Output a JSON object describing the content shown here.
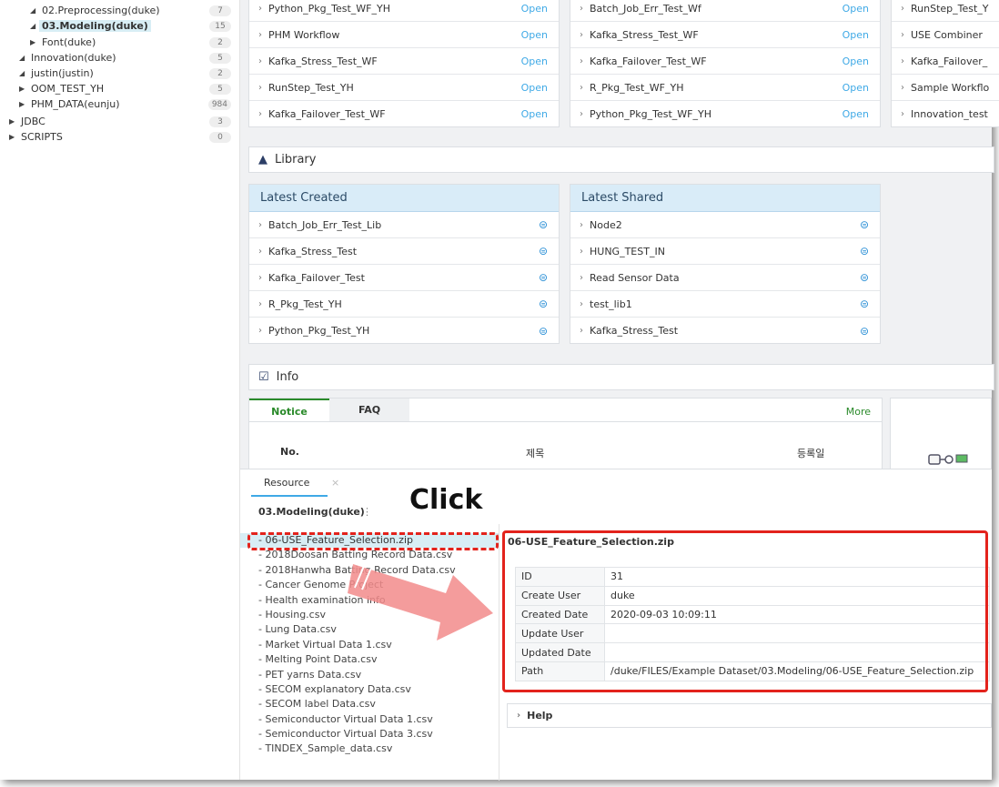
{
  "tree": {
    "items": [
      {
        "label": "02.Preprocessing(duke)",
        "count": "7",
        "arrow": "◢",
        "indent": 3
      },
      {
        "label": "03.Modeling(duke)",
        "count": "15",
        "arrow": "◢",
        "indent": 3,
        "selected": true
      },
      {
        "label": "Font(duke)",
        "count": "2",
        "arrow": "▶",
        "indent": 3
      },
      {
        "label": "Innovation(duke)",
        "count": "5",
        "arrow": "◢",
        "indent": 2
      },
      {
        "label": "justin(justin)",
        "count": "2",
        "arrow": "◢",
        "indent": 2
      },
      {
        "label": "OOM_TEST_YH",
        "count": "5",
        "arrow": "▶",
        "indent": 2
      },
      {
        "label": "PHM_DATA(eunju)",
        "count": "984",
        "arrow": "▶",
        "indent": 2
      },
      {
        "label": "JDBC",
        "count": "3",
        "arrow": "▶",
        "indent": 1
      },
      {
        "label": "SCRIPTS",
        "count": "0",
        "arrow": "▶",
        "indent": 1
      }
    ]
  },
  "workflows": {
    "col1": [
      "Python_Pkg_Test_WF_YH",
      "PHM Workflow",
      "Kafka_Stress_Test_WF",
      "RunStep_Test_YH",
      "Kafka_Failover_Test_WF"
    ],
    "col2": [
      "Batch_Job_Err_Test_Wf",
      "Kafka_Stress_Test_WF",
      "Kafka_Failover_Test_WF",
      "R_Pkg_Test_WF_YH",
      "Python_Pkg_Test_WF_YH"
    ],
    "col3": [
      "RunStep_Test_Y",
      "USE Combiner",
      "Kafka_Failover_",
      "Sample Workflo",
      "Innovation_test"
    ],
    "open_label": "Open"
  },
  "library": {
    "title": "Library",
    "latest_created": {
      "header": "Latest Created",
      "items": [
        "Batch_Job_Err_Test_Lib",
        "Kafka_Stress_Test",
        "Kafka_Failover_Test",
        "R_Pkg_Test_YH",
        "Python_Pkg_Test_YH"
      ]
    },
    "latest_shared": {
      "header": "Latest Shared",
      "items": [
        "Node2",
        "HUNG_TEST_IN",
        "Read Sensor Data",
        "test_lib1",
        "Kafka_Stress_Test"
      ]
    }
  },
  "info": {
    "title": "Info",
    "tabs": [
      "Notice",
      "FAQ"
    ],
    "more": "More",
    "columns": {
      "no": "No.",
      "title": "제목",
      "date": "등록일"
    }
  },
  "resource": {
    "tab_label": "Resource",
    "folder_title": "03.Modeling(duke)",
    "files": [
      "- 06-USE_Feature_Selection.zip",
      "- 2018Doosan Batting Record Data.csv",
      "- 2018Hanwha Batting Record Data.csv",
      "- Cancer Genome Project",
      "- Health examination info",
      "- Housing.csv",
      "- Lung Data.csv",
      "- Market Virtual Data 1.csv",
      "- Melting Point Data.csv",
      "- PET yarns Data.csv",
      "- SECOM explanatory Data.csv",
      "- SECOM label Data.csv",
      "- Semiconductor Virtual Data 1.csv",
      "- Semiconductor Virtual Data 3.csv",
      "- TINDEX_Sample_data.csv"
    ],
    "detail": {
      "title": "06-USE_Feature_Selection.zip",
      "rows": [
        {
          "key": "ID",
          "value": "31"
        },
        {
          "key": "Create User",
          "value": "duke"
        },
        {
          "key": "Created Date",
          "value": "2020-09-03 10:09:11"
        },
        {
          "key": "Update User",
          "value": ""
        },
        {
          "key": "Updated Date",
          "value": ""
        },
        {
          "key": "Path",
          "value": "/duke/FILES/Example Dataset/03.Modeling/06-USE_Feature_Selection.zip"
        }
      ]
    },
    "help_label": "Help"
  },
  "annotation": {
    "click_label": "Click",
    "highlight_color": "#e3231c",
    "arrow_color": "#f28b8b"
  }
}
